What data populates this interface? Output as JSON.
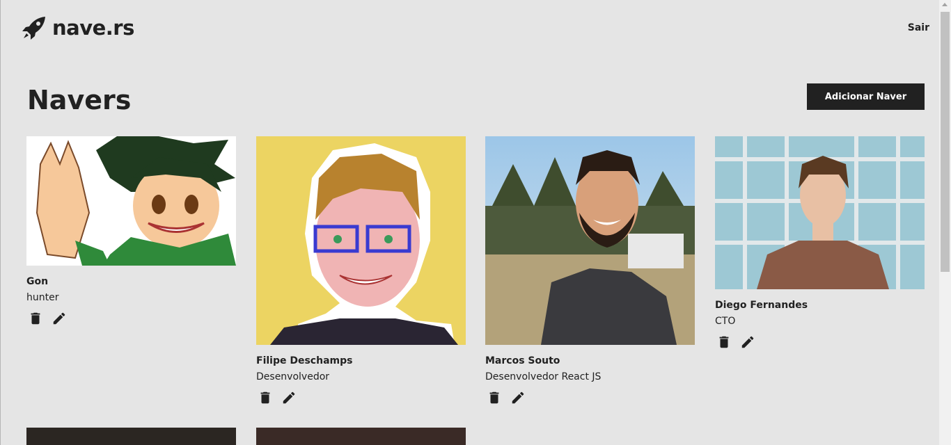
{
  "brand": {
    "name": "nave.rs",
    "icon": "rocket-icon"
  },
  "header": {
    "logout_label": "Sair"
  },
  "page": {
    "title": "Navers",
    "add_button_label": "Adicionar Naver"
  },
  "navers": [
    {
      "name": "Gon",
      "role": "hunter"
    },
    {
      "name": "Filipe Deschamps",
      "role": "Desenvolvedor"
    },
    {
      "name": "Marcos Souto",
      "role": "Desenvolvedor React JS"
    },
    {
      "name": "Diego Fernandes",
      "role": "CTO"
    }
  ],
  "actions": {
    "delete_icon": "trash-icon",
    "edit_icon": "pencil-icon"
  },
  "colors": {
    "background": "#e5e5e5",
    "primary": "#212121",
    "button_text": "#ffffff"
  }
}
